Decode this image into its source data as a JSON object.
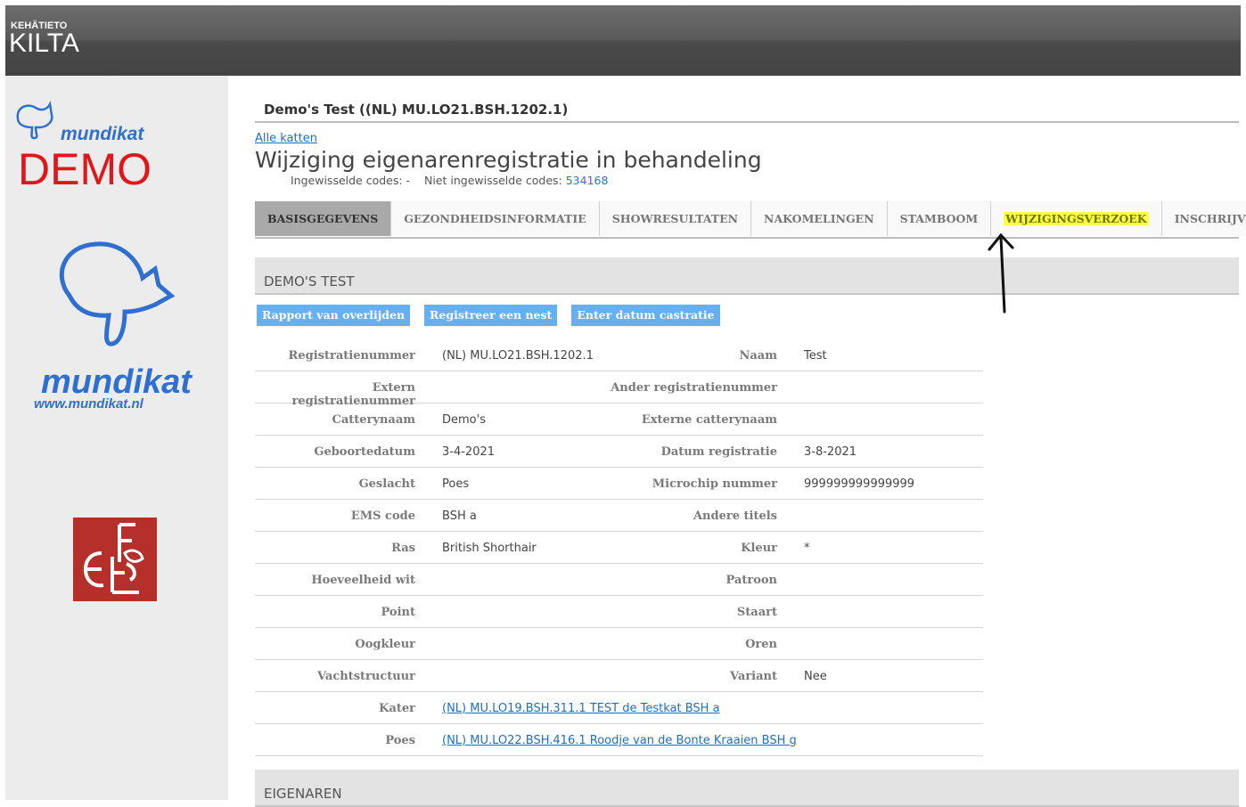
{
  "header": {
    "brand_small": "KEHÄTIETO",
    "brand_big": "KILTA"
  },
  "sidebar": {
    "demo_small": "mundikat",
    "demo_big": "DEMO",
    "mundikat_name": "mundikat",
    "mundikat_url": "www.mundikat.nl"
  },
  "cat": {
    "title": "Demo's Test ((NL) MU.LO21.BSH.1202.1)",
    "all_link": "Alle katten",
    "status_title": "Wijziging eigenarenregistratie in behandeling",
    "codes_redeemed": "Ingewisselde codes: -",
    "codes_not_redeemed_label": "Niet ingewisselde codes:",
    "codes_not_redeemed_value": "534168"
  },
  "tabs": [
    {
      "label": "BASISGEGEVENS",
      "active": true
    },
    {
      "label": "GEZONDHEIDSINFORMATIE"
    },
    {
      "label": "SHOWRESULTATEN"
    },
    {
      "label": "NAKOMELINGEN"
    },
    {
      "label": "STAMBOOM"
    },
    {
      "label": "WIJZIGINGSVERZOEK",
      "highlighted": true
    },
    {
      "label": "INSCHRIJVINGEN"
    }
  ],
  "section_title": "DEMO'S TEST",
  "buttons": {
    "death_report": "Rapport van overlijden",
    "register_litter": "Registreer een nest",
    "castration_date": "Enter datum castratie"
  },
  "details": [
    {
      "l1": "Registratienummer",
      "v1": "(NL) MU.LO21.BSH.1202.1",
      "l2": "Naam",
      "v2": "Test"
    },
    {
      "l1": "Extern registratienummer",
      "v1": "",
      "l2": "Ander registratienummer",
      "v2": ""
    },
    {
      "l1": "Catterynaam",
      "v1": "Demo's",
      "l2": "Externe catterynaam",
      "v2": ""
    },
    {
      "l1": "Geboortedatum",
      "v1": "3-4-2021",
      "l2": "Datum registratie",
      "v2": "3-8-2021"
    },
    {
      "l1": "Geslacht",
      "v1": "Poes",
      "l2": "Microchip nummer",
      "v2": "999999999999999"
    },
    {
      "l1": "EMS code",
      "v1": "BSH a",
      "l2": "Andere titels",
      "v2": ""
    },
    {
      "l1": "Ras",
      "v1": "British Shorthair",
      "l2": "Kleur",
      "v2": "*"
    },
    {
      "l1": "Hoeveelheid wit",
      "v1": "",
      "l2": "Patroon",
      "v2": ""
    },
    {
      "l1": "Point",
      "v1": "",
      "l2": "Staart",
      "v2": ""
    },
    {
      "l1": "Oogkleur",
      "v1": "",
      "l2": "Oren",
      "v2": ""
    },
    {
      "l1": "Vachtstructuur",
      "v1": "",
      "l2": "Variant",
      "v2": "Nee"
    },
    {
      "l1": "Kater",
      "v1": "(NL) MU.LO19.BSH.311.1 TEST de Testkat BSH a",
      "l2": "",
      "v2": ""
    },
    {
      "l1": "Poes",
      "v1": "(NL) MU.LO22.BSH.416.1 Roodje van de Bonte Kraaien BSH g",
      "l2": "",
      "v2": ""
    }
  ],
  "owners_section_title": "EIGENAREN",
  "colors": {
    "accent_button": "#67b0f0",
    "link": "#1f6fbf",
    "demo_red": "#e0161b",
    "mundikat_blue": "#2f6fd0",
    "highlight": "#ffff44"
  }
}
